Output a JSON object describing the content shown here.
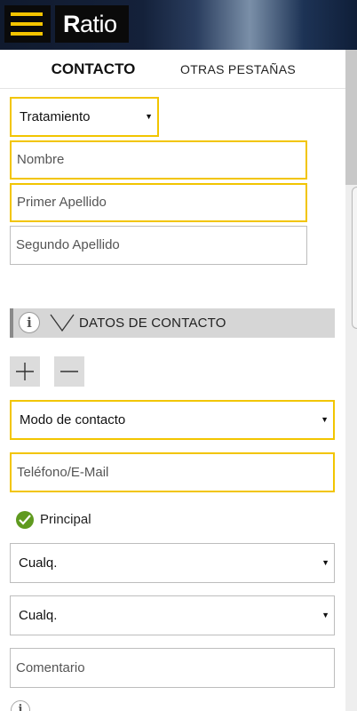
{
  "header": {
    "menu_icon": "hamburger-icon",
    "logo_text_bold": "R",
    "logo_text_rest": "atio",
    "accent_color": "#f5c400"
  },
  "tabs": [
    {
      "label": "CONTACTO",
      "active": true
    },
    {
      "label": "OTRAS PESTAÑAS",
      "active": false
    }
  ],
  "form": {
    "tratamiento": {
      "selected": "Tratamiento"
    },
    "nombre": {
      "placeholder": "Nombre"
    },
    "primer_apellido": {
      "placeholder": "Primer Apellido"
    },
    "segundo_apellido": {
      "placeholder": "Segundo Apellido"
    }
  },
  "contact_section": {
    "title": "DATOS DE CONTACTO",
    "info_icon": "info-icon",
    "add_icon": "plus-icon",
    "remove_icon": "minus-icon",
    "modo_contacto": {
      "selected": "Modo de contacto"
    },
    "telefono_email": {
      "placeholder": "Teléfono/E-Mail"
    },
    "principal_label": "Principal",
    "select_1": {
      "selected": "Cualq."
    },
    "select_2": {
      "selected": "Cualq."
    },
    "comentario": {
      "placeholder": "Comentario"
    }
  },
  "colors": {
    "highlight_border": "#f2c500",
    "check_green": "#5f9a1f",
    "section_bar": "#d6d6d6"
  }
}
